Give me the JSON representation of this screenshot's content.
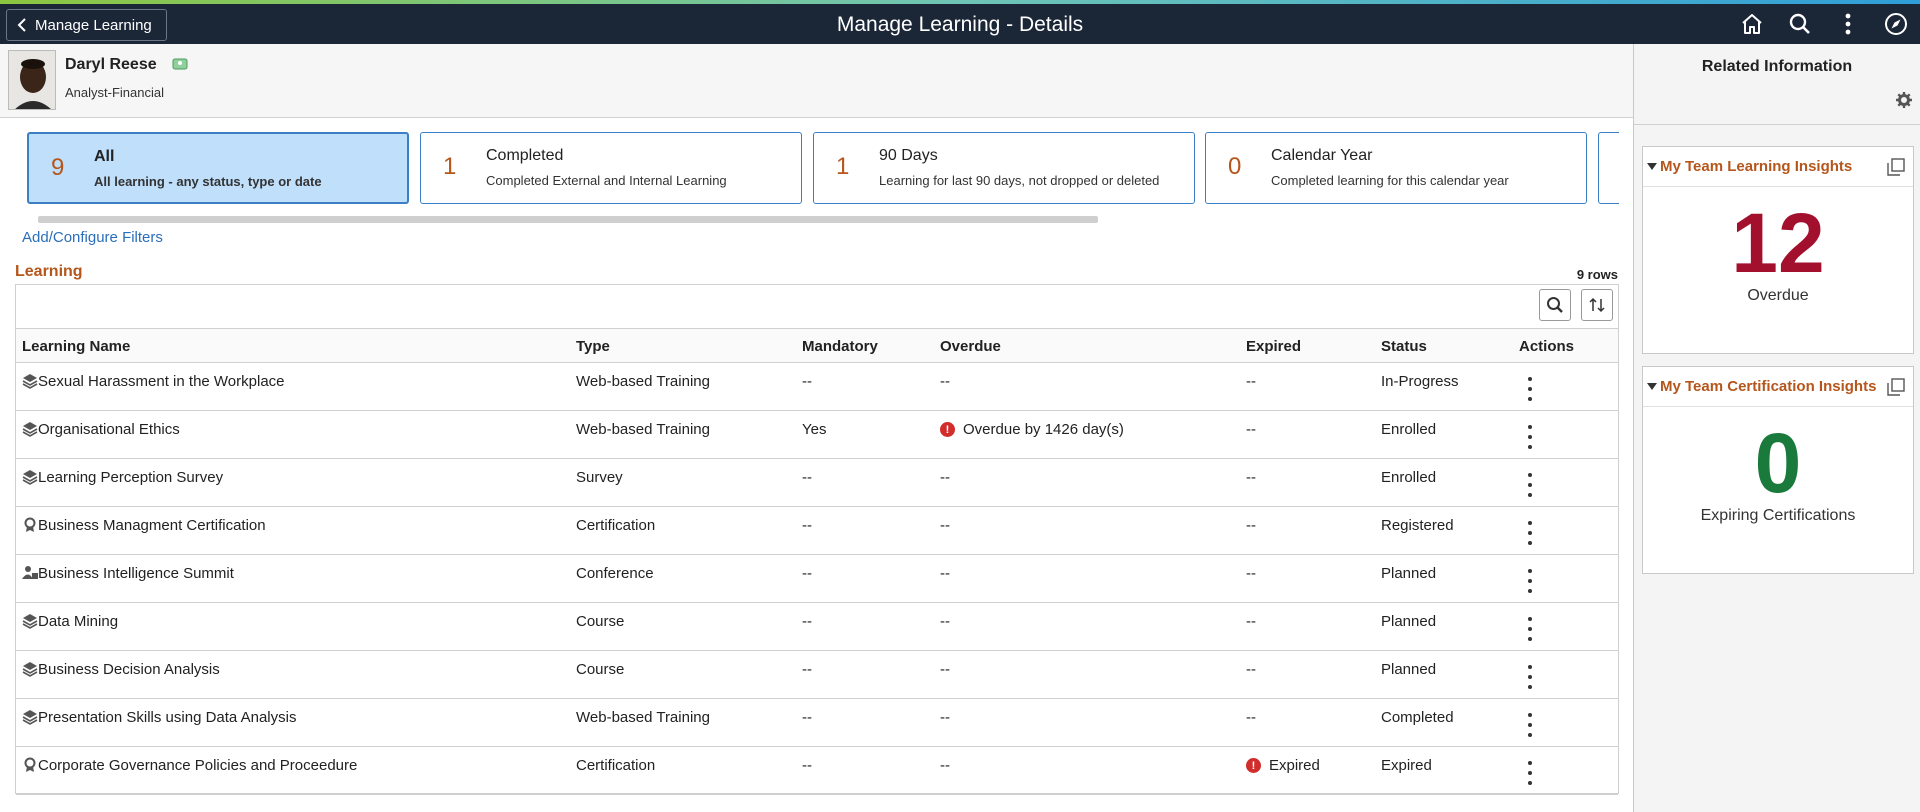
{
  "header": {
    "back_label": "Manage Learning",
    "title": "Manage Learning - Details",
    "icons": [
      "home-icon",
      "search-icon",
      "more-icon",
      "navbar-icon"
    ]
  },
  "person": {
    "name": "Daryl Reese",
    "job_title": "Analyst-Financial"
  },
  "tiles": [
    {
      "count": "9",
      "title": "All",
      "desc": "All learning - any status, type or date",
      "selected": true
    },
    {
      "count": "1",
      "title": "Completed",
      "desc": "Completed External and Internal Learning",
      "selected": false
    },
    {
      "count": "1",
      "title": "90 Days",
      "desc": "Learning for last 90 days, not dropped or deleted",
      "selected": false
    },
    {
      "count": "0",
      "title": "Calendar Year",
      "desc": "Completed learning for this calendar year",
      "selected": false
    }
  ],
  "filters_link": "Add/Configure Filters",
  "section_title": "Learning",
  "rows_count": "9 rows",
  "columns": [
    "Learning Name",
    "Type",
    "Mandatory",
    "Overdue",
    "Expired",
    "Status",
    "Actions"
  ],
  "rows": [
    {
      "icon": "stack-icon",
      "name": "Sexual Harassment in the Workplace",
      "type": "Web-based Training",
      "mandatory": "--",
      "overdue": "--",
      "expired": "--",
      "status": "In-Progress"
    },
    {
      "icon": "stack-icon",
      "name": "Organisational Ethics",
      "type": "Web-based Training",
      "mandatory": "Yes",
      "overdue": "Overdue by 1426 day(s)",
      "expired": "--",
      "status": "Enrolled"
    },
    {
      "icon": "stack-icon",
      "name": "Learning Perception Survey",
      "type": "Survey",
      "mandatory": "--",
      "overdue": "--",
      "expired": "--",
      "status": "Enrolled"
    },
    {
      "icon": "ribbon-icon",
      "name": "Business Managment Certification",
      "type": "Certification",
      "mandatory": "--",
      "overdue": "--",
      "expired": "--",
      "status": "Registered"
    },
    {
      "icon": "conference-icon",
      "name": "Business Intelligence Summit",
      "type": "Conference",
      "mandatory": "--",
      "overdue": "--",
      "expired": "--",
      "status": "Planned"
    },
    {
      "icon": "stack-icon",
      "name": "Data Mining",
      "type": "Course",
      "mandatory": "--",
      "overdue": "--",
      "expired": "--",
      "status": "Planned"
    },
    {
      "icon": "stack-icon",
      "name": "Business Decision Analysis",
      "type": "Course",
      "mandatory": "--",
      "overdue": "--",
      "expired": "--",
      "status": "Planned"
    },
    {
      "icon": "stack-icon",
      "name": "Presentation Skills using Data Analysis",
      "type": "Web-based Training",
      "mandatory": "--",
      "overdue": "--",
      "expired": "--",
      "status": "Completed"
    },
    {
      "icon": "ribbon-icon",
      "name": "Corporate Governance Policies and Proceedure",
      "type": "Certification",
      "mandatory": "--",
      "overdue": "--",
      "expired": "Expired",
      "status": "Expired"
    }
  ],
  "related": {
    "title": "Related Information",
    "cards": [
      {
        "title": "My Team Learning Insights",
        "value": "12",
        "label": "Overdue",
        "color": "#a3102e"
      },
      {
        "title": "My Team Certification Insights",
        "value": "0",
        "label": "Expiring Certifications",
        "color": "#1a7a3c"
      }
    ]
  },
  "colors": {
    "header_bg": "#1b2637",
    "accent": "#b5561c",
    "link": "#2a6ebb",
    "selected_tile": "#bfdffb",
    "error": "#d22d2d"
  }
}
